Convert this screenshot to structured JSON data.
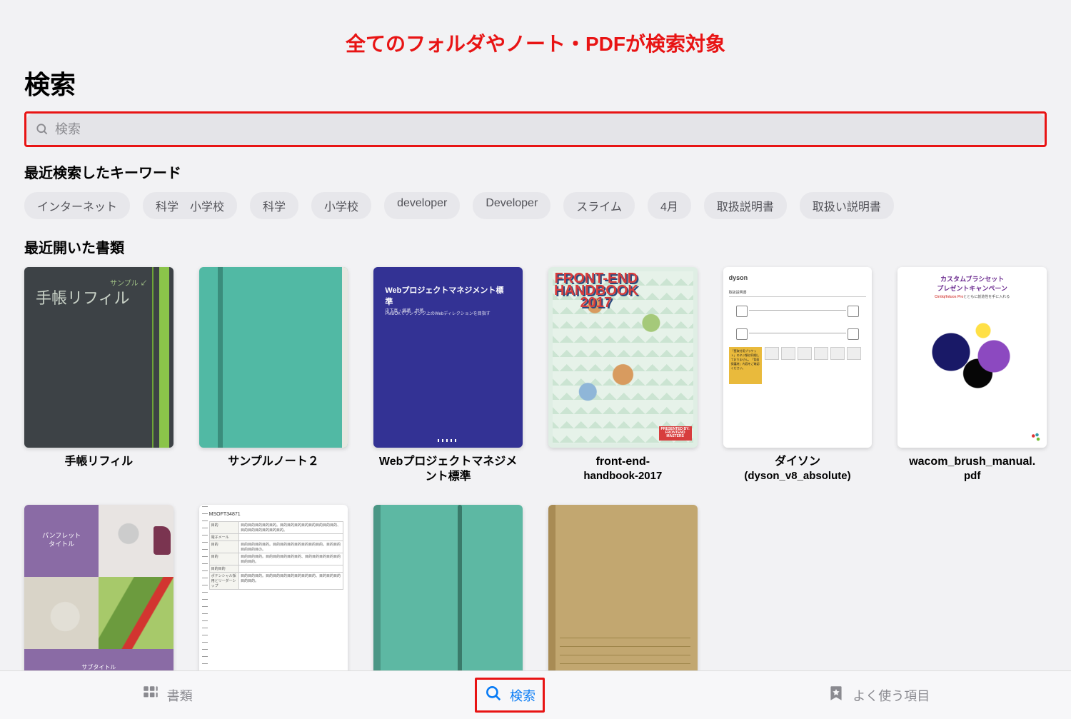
{
  "annotation": "全てのフォルダやノート・PDFが検索対象",
  "page_title": "検索",
  "search": {
    "placeholder": "検索",
    "value": ""
  },
  "recent_keywords_heading": "最近検索したキーワード",
  "keywords": [
    "インターネット",
    "科学　小学校",
    "科学",
    "小学校",
    "developer",
    "Developer",
    "スライム",
    "4月",
    "取扱説明書",
    "取扱い説明書"
  ],
  "recent_docs_heading": "最近開いた書類",
  "docs_row1": [
    {
      "label": "手帳リフィル",
      "label2": "",
      "thumb": {
        "kind": "t0",
        "handwriting": "手帳リフィル",
        "arrow": "サンプル"
      }
    },
    {
      "label": "サンプルノート２",
      "label2": "",
      "thumb": {
        "kind": "t1"
      }
    },
    {
      "label": "Webプロジェクトマネジメント標準",
      "label2": "",
      "thumb": {
        "kind": "t2",
        "title": "Webプロジェクトマネジメント標準",
        "sub": "PMBOKでワンランク上のWebディレクションを目指す",
        "author": "中下真・編著　共著"
      }
    },
    {
      "label": "front-end-",
      "label2": "handbook-2017",
      "thumb": {
        "kind": "t3",
        "year": "FRONT-END\nHANDBOOK\n2017",
        "badge": "PRESENTED BY:\nFRONTEND\nMASTERS"
      }
    },
    {
      "label": "ダイソン",
      "label2": "(dyson_v8_absolute)",
      "thumb": {
        "kind": "t4",
        "brand": "dyson",
        "sec": "取扱説明書",
        "yellow_text": "「壁取付用ブラケット」のネジ類は同梱しておりません。「背面保護材」内容をご確認ください。"
      }
    },
    {
      "label": "wacom_brush_manual.",
      "label2": "pdf",
      "thumb": {
        "kind": "t5",
        "h1": "カスタムブラシセット",
        "h2": "プレゼントキャンペーン",
        "sub": "Cintiq/Intuos Proとともに創造性を手に入れる"
      }
    }
  ],
  "docs_row2": [
    {
      "thumb": {
        "kind": "t6",
        "title": "パンフレット\nタイトル",
        "subtitle": "サブタイトル"
      }
    },
    {
      "thumb": {
        "kind": "t7",
        "code": "MSOFT34871",
        "rows": [
          [
            "目的",
            "目的目的目的目的目的。目的目的目的目的目的目的目的目的、目的目的目的目的目的目的。"
          ],
          [
            "電子メール",
            ""
          ],
          [
            "目的",
            "目的目的目的目的。目的目的目的目的目的目的目的。目的目的目的目的目の。"
          ],
          [
            "目的",
            "目的目的目的。目的目的目的目的目的、目的目的目的目的目的目的目的。"
          ],
          [
            "目的目的",
            ""
          ],
          [
            "ポテンシャル採用とリーダーシップ",
            "目的目的目的。目的目的目的目的目的目的目的、目的目的目的目的目的。"
          ]
        ]
      }
    },
    {
      "thumb": {
        "kind": "t8"
      }
    },
    {
      "thumb": {
        "kind": "t9"
      }
    },
    {
      "thumb": null
    },
    {
      "thumb": null
    }
  ],
  "tabs": {
    "documents": "書類",
    "search": "検索",
    "favorites": "よく使う項目"
  }
}
